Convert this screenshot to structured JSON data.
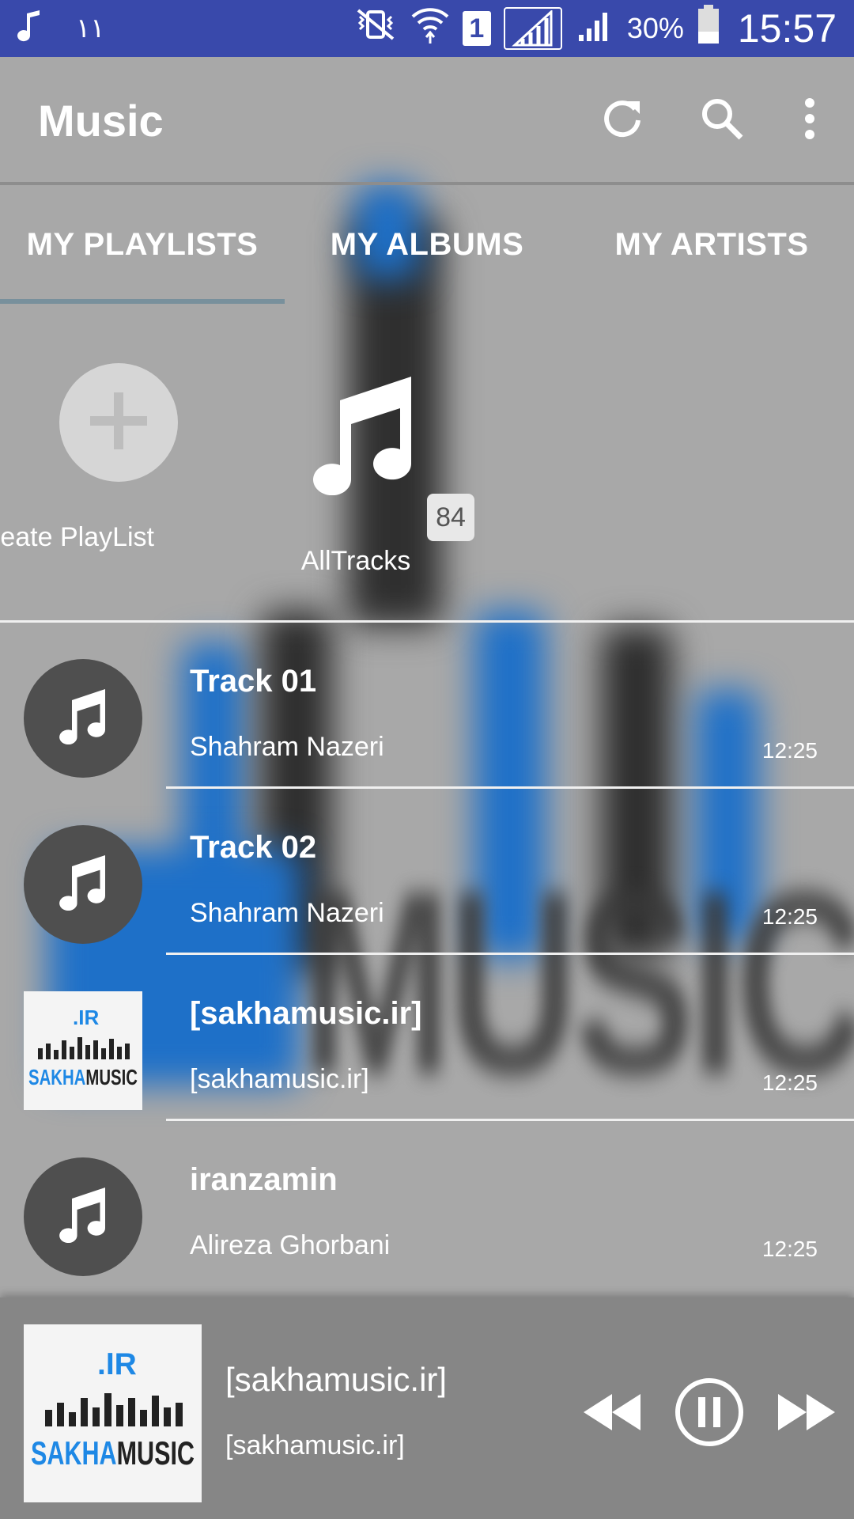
{
  "status_bar": {
    "time": "15:57",
    "battery_percent": "30%",
    "sim_slot": "1",
    "left_indicator": "۱۱"
  },
  "app_bar": {
    "title": "Music"
  },
  "tabs": [
    {
      "label": "MY PLAYLISTS",
      "selected": true
    },
    {
      "label": "MY ALBUMS",
      "selected": false
    },
    {
      "label": "MY ARTISTS",
      "selected": false
    }
  ],
  "playlists": {
    "create_label": "Create PlayList",
    "all_tracks_label": "AllTracks",
    "all_tracks_count": "84"
  },
  "tracks": [
    {
      "title": "Track 01",
      "artist": "Shahram Nazeri",
      "duration": "12:25",
      "thumb": "music-note"
    },
    {
      "title": "Track 02",
      "artist": "Shahram Nazeri",
      "duration": "12:25",
      "thumb": "music-note"
    },
    {
      "title": "[sakhamusic.ir]",
      "artist": "[sakhamusic.ir]",
      "duration": "12:25",
      "thumb": "sakhamusic-logo"
    },
    {
      "title": "iranzamin",
      "artist": "Alireza Ghorbani",
      "duration": "12:25",
      "thumb": "music-note"
    }
  ],
  "now_playing": {
    "title": "[sakhamusic.ir]",
    "artist": "[sakhamusic.ir]",
    "is_playing": true
  },
  "logo": {
    "top": ".IR",
    "left": "SAKHA",
    "right": "MUSIC"
  },
  "colors": {
    "status_bar": "#3949ab",
    "tab_indicator": "#78909c",
    "logo_blue": "#1e88e5",
    "logo_dark": "#222222"
  }
}
